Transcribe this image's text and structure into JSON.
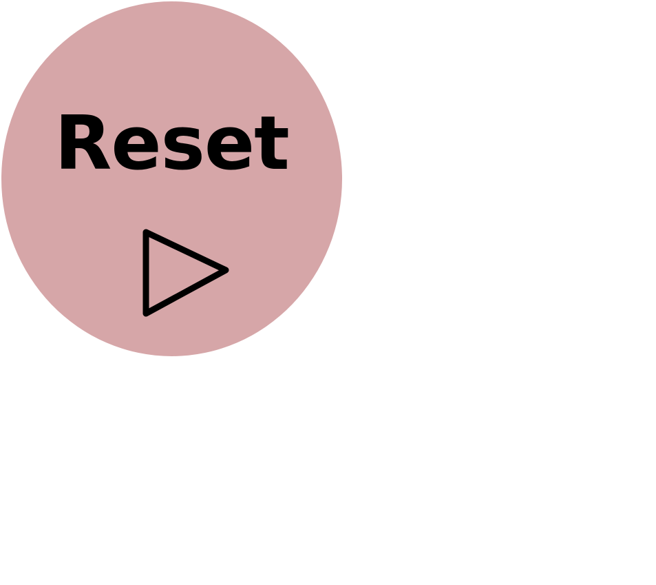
{
  "reset_control": {
    "label": "Reset",
    "icon": "play-icon",
    "background_color": "#d6a6a8",
    "foreground_color": "#000000"
  }
}
